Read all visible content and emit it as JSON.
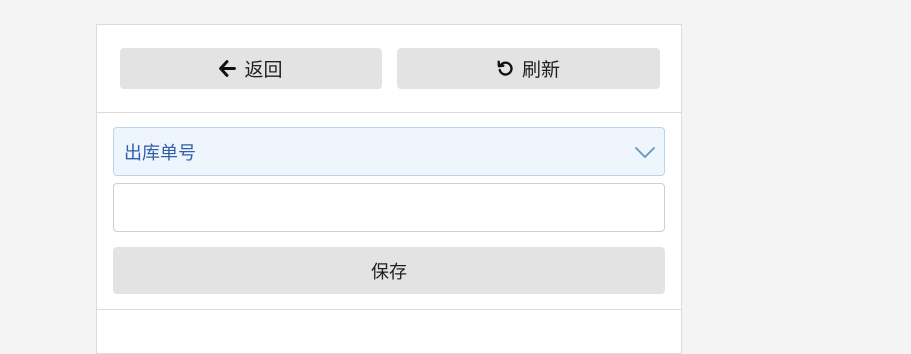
{
  "toolbar": {
    "back_label": "返回",
    "back_icon": "arrow-left-icon",
    "refresh_label": "刷新",
    "refresh_icon": "rotate-ccw-icon"
  },
  "form": {
    "select_label": "出库单号",
    "select_icon": "chevron-down-icon",
    "input_value": "",
    "input_placeholder": "",
    "save_label": "保存"
  },
  "colors": {
    "page_bg": "#f4f4f4",
    "button_bg": "#e3e3e3",
    "select_bg": "#eef5fd",
    "select_text": "#2f5fa8"
  }
}
